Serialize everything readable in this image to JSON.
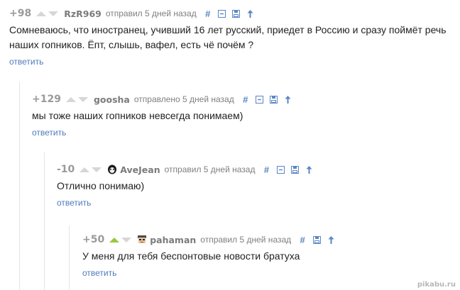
{
  "comments": [
    {
      "rating": "+98",
      "author": "RzR969",
      "meta": "отправил 5 дней назад",
      "text_lines": [
        "Сомневаюсь, что иностранец, учивший 16 лет русский, приедет в Россию и сразу поймёт речь",
        "наших гопников. Ёпт, слышь, вафел, есть чё почём ?"
      ],
      "reply_label": "ответить"
    },
    {
      "rating": "+129",
      "author": "goosha",
      "meta": "отправлено 5 дней назад",
      "text_lines": [
        "мы тоже наших гопников невсегда понимаем)"
      ],
      "reply_label": "ответить"
    },
    {
      "rating": "-10",
      "author": "AveJean",
      "meta": "отправил 5 дней назад",
      "text_lines": [
        "Отлично понимаю)"
      ],
      "reply_label": "ответить"
    },
    {
      "rating": "+50",
      "author": "pahaman",
      "meta": "отправил 5 дней назад",
      "text_lines": [
        "У меня для тебя беспонтовые новости братуха"
      ],
      "reply_label": "ответить"
    }
  ],
  "icons": [
    "hash-icon",
    "collapse-icon",
    "save-icon",
    "arrow-up-icon"
  ],
  "colors": {
    "vote_active": "#97c83f",
    "link": "#4f7bbd",
    "tool": "#5a86c5"
  },
  "watermark": "pikabu.ru"
}
